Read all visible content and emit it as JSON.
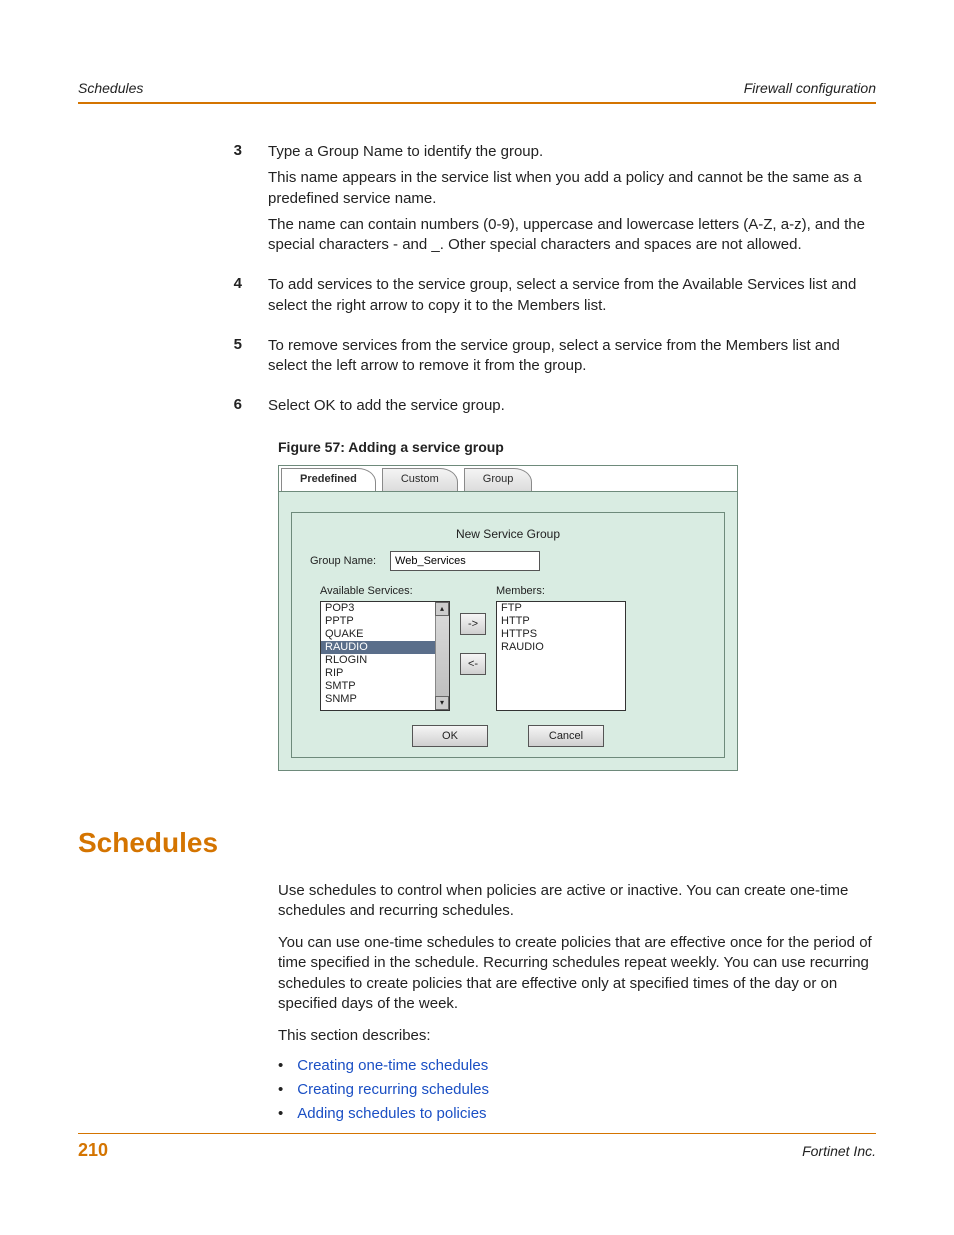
{
  "runhead": {
    "left": "Schedules",
    "right": "Firewall configuration"
  },
  "steps": [
    {
      "n": "3",
      "paras": [
        "Type a Group Name to identify the group.",
        "This name appears in the service list when you add a policy and cannot be the same as a predefined service name.",
        "The name can contain numbers (0-9), uppercase and lowercase letters (A-Z, a-z), and the special characters - and _. Other special characters and spaces are not allowed."
      ]
    },
    {
      "n": "4",
      "paras": [
        "To add services to the service group, select a service from the Available Services list and select the right arrow to copy it to the Members list."
      ]
    },
    {
      "n": "5",
      "paras": [
        "To remove services from the service group, select a service from the Members list and select the left arrow to remove it from the group."
      ]
    },
    {
      "n": "6",
      "paras": [
        "Select OK to add the service group."
      ]
    }
  ],
  "figure_caption": "Figure 57: Adding a service group",
  "shot": {
    "tabs": {
      "predefined": "Predefined",
      "custom": "Custom",
      "group": "Group"
    },
    "panel_title": "New Service Group",
    "group_name_label": "Group Name:",
    "group_name_value": "Web_Services",
    "available_label": "Available Services:",
    "members_label": "Members:",
    "available": [
      "POP3",
      "PPTP",
      "QUAKE",
      "RAUDIO",
      "RLOGIN",
      "RIP",
      "SMTP",
      "SNMP"
    ],
    "available_selected_index": 3,
    "members": [
      "FTP",
      "HTTP",
      "HTTPS",
      "RAUDIO"
    ],
    "arrow_right": "->",
    "arrow_left": "<-",
    "ok": "OK",
    "cancel": "Cancel"
  },
  "section_heading": "Schedules",
  "prose": {
    "p1": "Use schedules to control when policies are active or inactive. You can create one-time schedules and recurring schedules.",
    "p2": "You can use one-time schedules to create policies that are effective once for the period of time specified in the schedule. Recurring schedules repeat weekly. You can use recurring schedules to create policies that are effective only at specified times of the day or on specified days of the week.",
    "p3": "This section describes:"
  },
  "links": [
    "Creating one-time schedules",
    "Creating recurring schedules",
    "Adding schedules to policies"
  ],
  "footer": {
    "page": "210",
    "right": "Fortinet Inc."
  }
}
